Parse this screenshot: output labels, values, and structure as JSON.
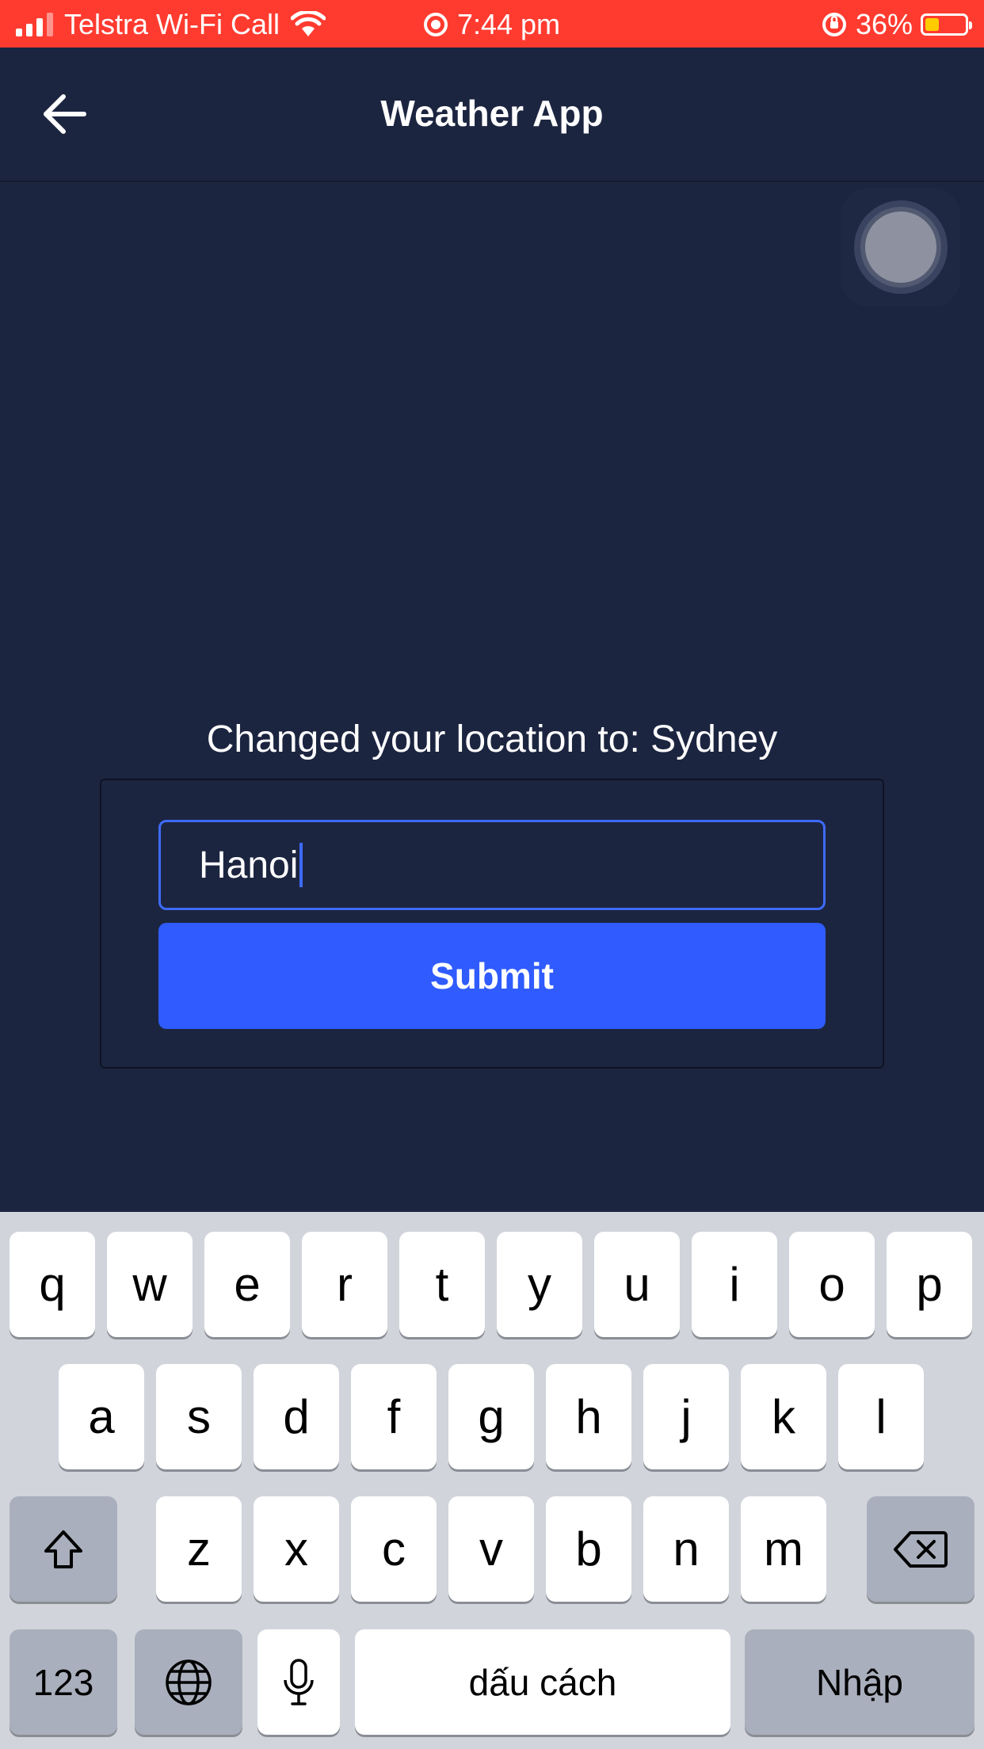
{
  "status_bar": {
    "carrier": "Telstra Wi-Fi Call",
    "time": "7:44 pm",
    "battery": "36%",
    "battery_level": 0.36
  },
  "nav": {
    "title": "Weather App",
    "back_icon": "arrow-left-icon"
  },
  "content": {
    "message": "Changed your location to: Sydney",
    "location_input_value": "Hanoi",
    "submit_label": "Submit"
  },
  "keyboard": {
    "row1": [
      "q",
      "w",
      "e",
      "r",
      "t",
      "y",
      "u",
      "i",
      "o",
      "p"
    ],
    "row2": [
      "a",
      "s",
      "d",
      "f",
      "g",
      "h",
      "j",
      "k",
      "l"
    ],
    "row3": [
      "z",
      "x",
      "c",
      "v",
      "b",
      "n",
      "m"
    ],
    "numbers_key": "123",
    "space_key": "dấu cách",
    "return_key": "Nhập",
    "icons": [
      "shift-icon",
      "backspace-icon",
      "globe-icon",
      "microphone-icon"
    ]
  },
  "colors": {
    "status_bar": "#ff3b30",
    "background": "#1c2540",
    "accent": "#2f5bff",
    "battery_fill": "#ffcc00"
  }
}
